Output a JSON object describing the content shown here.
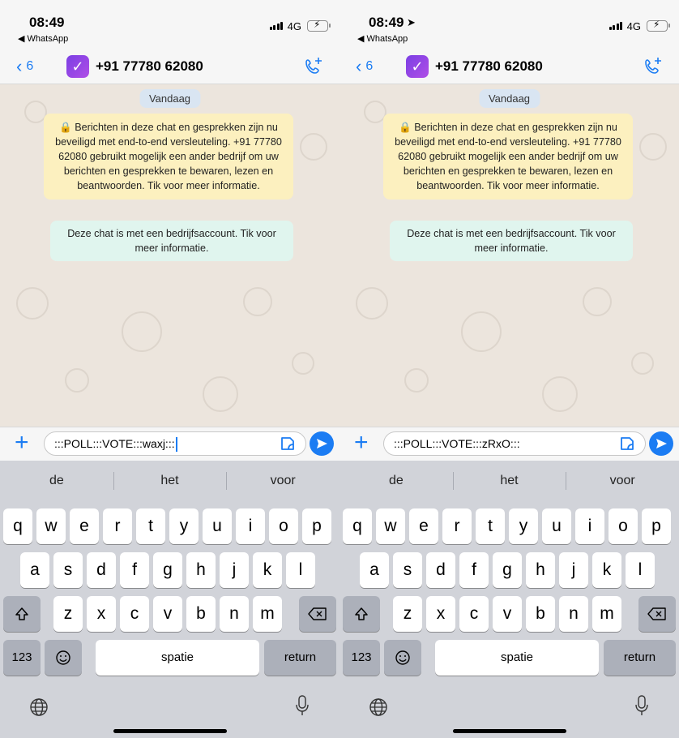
{
  "screens": [
    {
      "id": "left",
      "status": {
        "time": "08:49",
        "back_app": "◀ WhatsApp",
        "network": "4G",
        "show_location_arrow": false
      },
      "header": {
        "back_count": "6",
        "contact": "+91 77780 62080"
      },
      "chat": {
        "date_label": "Vandaag",
        "encryption_notice": "🔒 Berichten in deze chat en gesprekken zijn nu beveiligd met end-to-end versleuteling. +91 77780 62080 gebruikt mogelijk een ander bedrijf om uw berichten en gesprekken te bewaren, lezen en beantwoorden. Tik voor meer informatie.",
        "business_notice": "Deze chat is met een bedrijfsaccount. Tik voor meer informatie."
      },
      "input": {
        "value": ":::POLL:::VOTE:::waxj:::"
      },
      "keyboard": {
        "suggestions": [
          "de",
          "het",
          "voor"
        ],
        "row1": [
          "q",
          "w",
          "e",
          "r",
          "t",
          "y",
          "u",
          "i",
          "o",
          "p"
        ],
        "row2": [
          "a",
          "s",
          "d",
          "f",
          "g",
          "h",
          "j",
          "k",
          "l"
        ],
        "row3": [
          "z",
          "x",
          "c",
          "v",
          "b",
          "n",
          "m"
        ],
        "numbers_label": "123",
        "space_label": "spatie",
        "return_label": "return"
      }
    },
    {
      "id": "right",
      "status": {
        "time": "08:49",
        "back_app": "◀ WhatsApp",
        "network": "4G",
        "show_location_arrow": true
      },
      "header": {
        "back_count": "6",
        "contact": "+91 77780 62080"
      },
      "chat": {
        "date_label": "Vandaag",
        "encryption_notice": "🔒 Berichten in deze chat en gesprekken zijn nu beveiligd met end-to-end versleuteling. +91 77780 62080 gebruikt mogelijk een ander bedrijf om uw berichten en gesprekken te bewaren, lezen en beantwoorden. Tik voor meer informatie.",
        "business_notice": "Deze chat is met een bedrijfsaccount. Tik voor meer informatie."
      },
      "input": {
        "value": ":::POLL:::VOTE:::zRxO:::"
      },
      "keyboard": {
        "suggestions": [
          "de",
          "het",
          "voor"
        ],
        "row1": [
          "q",
          "w",
          "e",
          "r",
          "t",
          "y",
          "u",
          "i",
          "o",
          "p"
        ],
        "row2": [
          "a",
          "s",
          "d",
          "f",
          "g",
          "h",
          "j",
          "k",
          "l"
        ],
        "row3": [
          "z",
          "x",
          "c",
          "v",
          "b",
          "n",
          "m"
        ],
        "numbers_label": "123",
        "space_label": "spatie",
        "return_label": "return"
      }
    }
  ],
  "colors": {
    "accent": "#1b7cf3",
    "chat_bg": "#ece5dd",
    "encryption_bg": "#fcf0bf",
    "business_bg": "#e0f5ee",
    "keyboard_bg": "#d1d3d9"
  }
}
